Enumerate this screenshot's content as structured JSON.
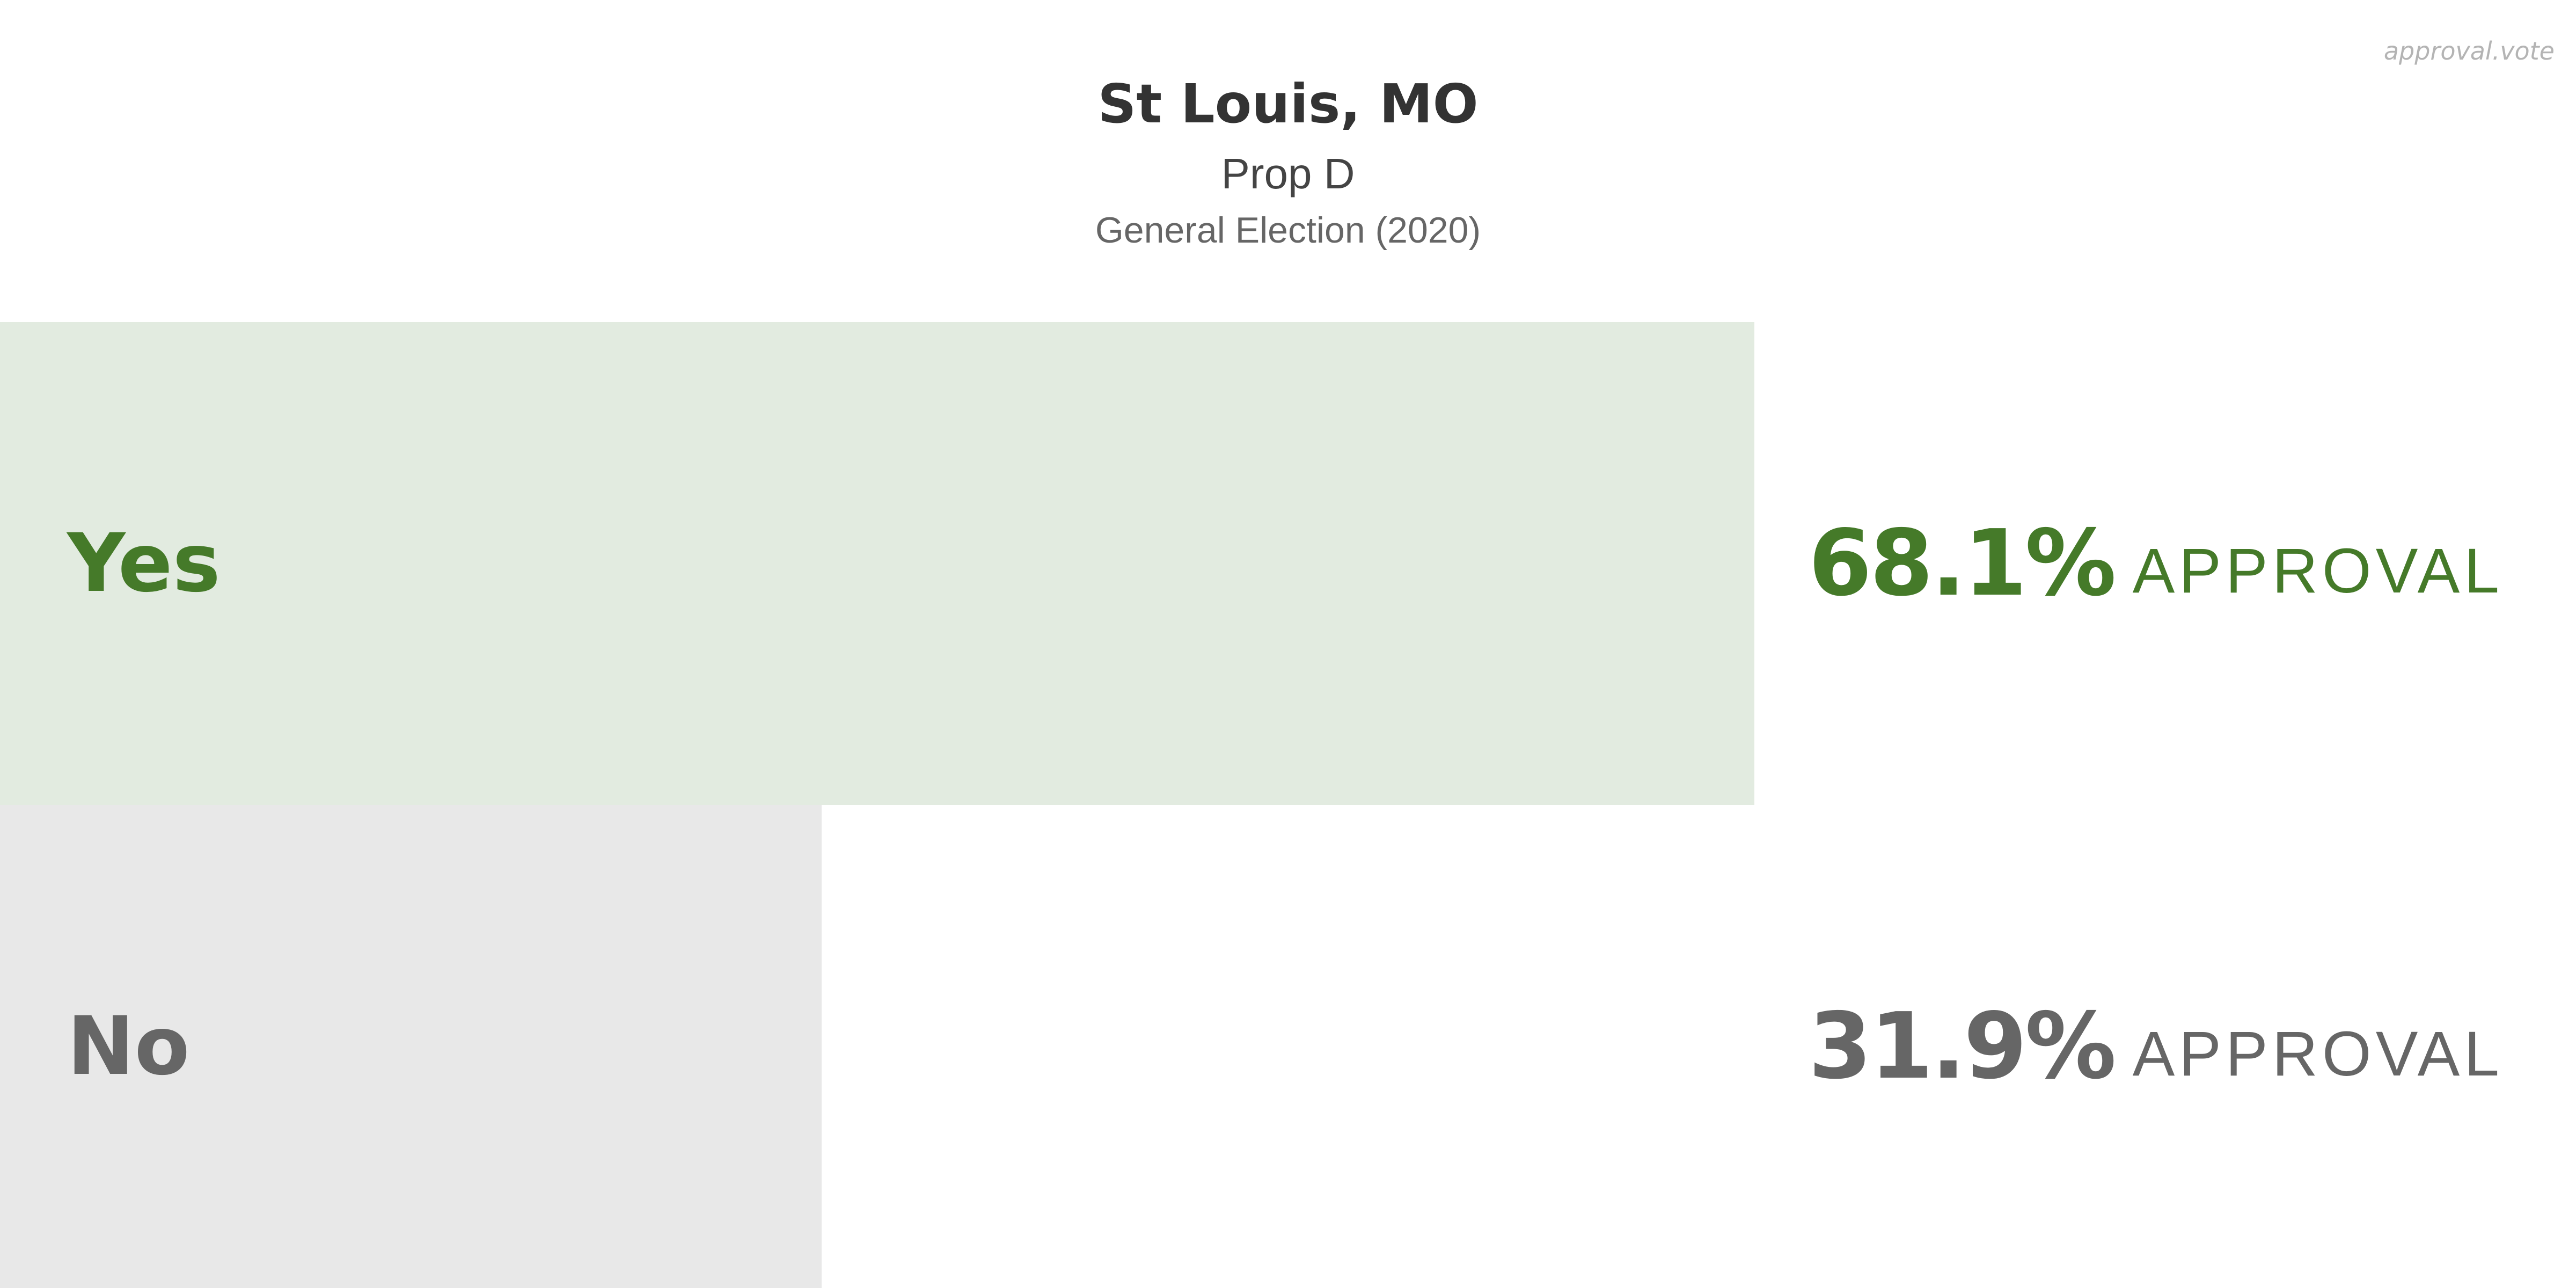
{
  "watermark": "approval.vote",
  "header": {
    "title": "St Louis, MO",
    "subtitle": "Prop D",
    "election": "General Election (2020)"
  },
  "colors": {
    "yes_text": "#457a29",
    "yes_bar": "#e2ebe0",
    "no_text": "#666666",
    "no_bar": "#e8e8e8"
  },
  "chart_data": {
    "type": "bar",
    "orientation": "horizontal",
    "categories": [
      "Yes",
      "No"
    ],
    "values": [
      68.1,
      31.9
    ],
    "value_labels": [
      "68.1%",
      "31.9%"
    ],
    "value_suffix": "APPROVAL",
    "xlim": [
      0,
      100
    ],
    "grid": false
  }
}
